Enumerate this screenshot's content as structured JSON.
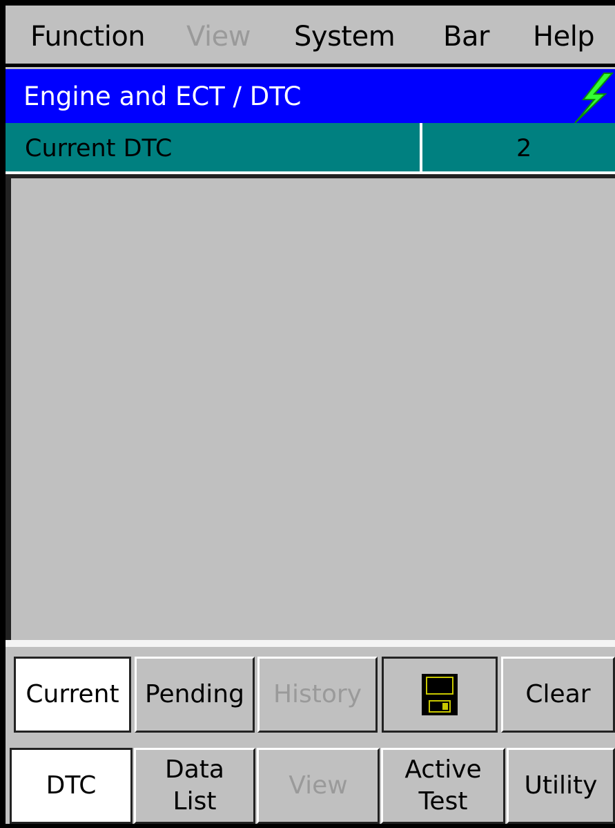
{
  "menu": {
    "items": [
      {
        "label": "Function",
        "enabled": true
      },
      {
        "label": "View",
        "enabled": false
      },
      {
        "label": "System",
        "enabled": true
      },
      {
        "label": "Bar",
        "enabled": true
      },
      {
        "label": "Help",
        "enabled": true
      }
    ]
  },
  "titlebar": {
    "title": "Engine and ECT / DTC",
    "icon": "lightning-bolt-icon",
    "color": "#0000ff"
  },
  "dtc_summary": {
    "label": "Current DTC",
    "count": "2",
    "color": "#008080"
  },
  "dtc_buttons": [
    {
      "label": "Current",
      "active": true,
      "enabled": true
    },
    {
      "label": "Pending",
      "active": false,
      "enabled": true
    },
    {
      "label": "History",
      "active": false,
      "enabled": false
    },
    {
      "icon": "floppy-disk-icon",
      "active": false,
      "enabled": true
    },
    {
      "label": "Clear",
      "active": false,
      "enabled": true
    }
  ],
  "nav_buttons": [
    {
      "line1": "DTC",
      "line2": "",
      "active": true,
      "enabled": true
    },
    {
      "line1": "Data",
      "line2": "List",
      "active": false,
      "enabled": true
    },
    {
      "line1": "View",
      "line2": "",
      "active": false,
      "enabled": false
    },
    {
      "line1": "Active",
      "line2": "Test",
      "active": false,
      "enabled": true
    },
    {
      "line1": "Utility",
      "line2": "",
      "active": false,
      "enabled": true
    }
  ]
}
